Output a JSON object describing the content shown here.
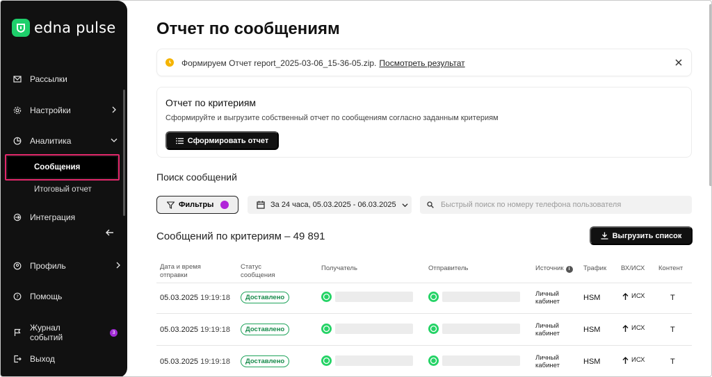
{
  "app": {
    "logo_text": "edna pulse"
  },
  "sidebar": {
    "items": [
      {
        "label": "Рассылки",
        "icon": "mail-icon"
      },
      {
        "label": "Настройки",
        "icon": "gear-icon"
      },
      {
        "label": "Аналитика",
        "icon": "pie-chart-icon"
      },
      {
        "label": "Интеграция",
        "icon": "integration-icon"
      },
      {
        "label": "Профиль",
        "icon": "user-icon"
      },
      {
        "label": "Помощь",
        "icon": "help-icon"
      },
      {
        "label": "Журнал событий",
        "icon": "flag-icon",
        "badge": "3"
      },
      {
        "label": "Выход",
        "icon": "logout-icon"
      }
    ],
    "analytics_sub": [
      {
        "label": "Сообщения",
        "active": true
      },
      {
        "label": "Итоговый отчет",
        "active": false
      }
    ]
  },
  "main": {
    "title": "Отчет по сообщениям",
    "notice": {
      "text": "Формируем Отчет report_2025-03-06_15-36-05.zip.",
      "link": "Посмотреть результат"
    },
    "criteria_card": {
      "title": "Отчет по критериям",
      "description": "Сформируйте и выгрузите собственный отчет по сообщениям согласно заданным критериям",
      "button": "Сформировать отчет"
    },
    "search_section": {
      "title": "Поиск сообщений",
      "filters_button": "Фильтры",
      "date_range": "За 24 часа, 05.03.2025 - 06.03.2025",
      "search_placeholder": "Быстрый поиск по номеру телефона пользователя"
    },
    "results": {
      "title": "Сообщений по критериям – 49 891",
      "export_button": "Выгрузить список"
    },
    "table": {
      "headers": {
        "date": [
          "Дата и время",
          "отправки"
        ],
        "status": [
          "Статус",
          "сообщения"
        ],
        "recipient": "Получатель",
        "sender": "Отправитель",
        "source": "Источник",
        "traffic": "Трафик",
        "direction": "ВХ/ИСХ",
        "content": "Контент"
      },
      "rows": [
        {
          "date": "05.03.2025",
          "time": "19:19:18",
          "status": "Доставлено",
          "source": [
            "Личный",
            "кабинет"
          ],
          "traffic": "HSM",
          "direction": "ИСХ",
          "content": "T"
        },
        {
          "date": "05.03.2025",
          "time": "19:19:18",
          "status": "Доставлено",
          "source": [
            "Личный",
            "кабинет"
          ],
          "traffic": "HSM",
          "direction": "ИСХ",
          "content": "T"
        },
        {
          "date": "05.03.2025",
          "time": "19:19:18",
          "status": "Доставлено",
          "source": [
            "Личный",
            "кабинет"
          ],
          "traffic": "HSM",
          "direction": "ИСХ",
          "content": "T"
        }
      ]
    }
  },
  "colors": {
    "sidebar_bg": "#111111",
    "accent_green": "#1ecf6b",
    "active_outline": "#e2286b",
    "filter_dot": "#b024d8",
    "status_green": "#1ea35a",
    "notice_clock": "#f5b400"
  }
}
